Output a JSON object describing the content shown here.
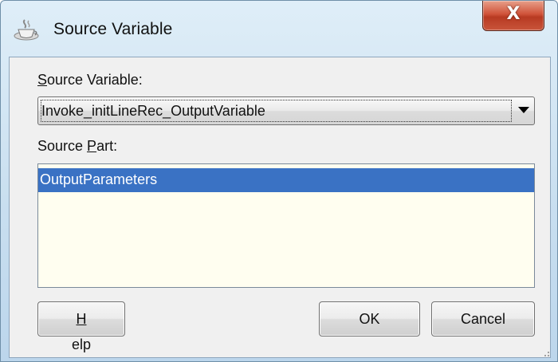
{
  "window": {
    "title": "Source Variable",
    "close_glyph": "X",
    "title_icon": "coffee-cup-icon"
  },
  "form": {
    "variable": {
      "label_mnemonic": "S",
      "label_rest": "ource Variable:",
      "selected_value": "Invoke_initLineRec_OutputVariable"
    },
    "part": {
      "label_before": "Source ",
      "label_mnemonic": "P",
      "label_after": "art:",
      "items": [
        "OutputParameters"
      ]
    }
  },
  "buttons": {
    "help_mnemonic": "H",
    "help_rest": "elp",
    "ok": "OK",
    "cancel": "Cancel"
  }
}
